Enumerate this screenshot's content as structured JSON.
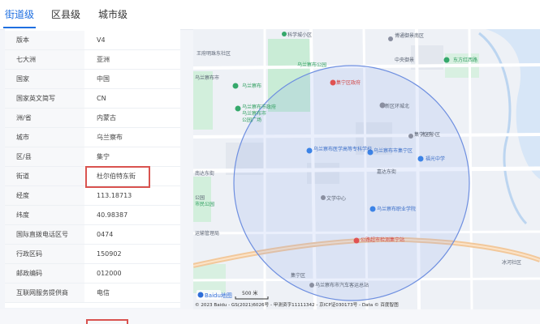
{
  "tabs": [
    "街道级",
    "区县级",
    "城市级"
  ],
  "info_rows": [
    {
      "key": "版本",
      "value": "V4"
    },
    {
      "key": "七大洲",
      "value": "亚洲"
    },
    {
      "key": "国家",
      "value": "中国"
    },
    {
      "key": "国家英文简写",
      "value": "CN"
    },
    {
      "key": "洲/省",
      "value": "内蒙古"
    },
    {
      "key": "城市",
      "value": "乌兰察布"
    },
    {
      "key": "区/县",
      "value": "集宁"
    },
    {
      "key": "街道",
      "value": "杜尔伯特东街"
    },
    {
      "key": "经度",
      "value": "113.18713"
    },
    {
      "key": "纬度",
      "value": "40.98387"
    },
    {
      "key": "国际直拨电话区号",
      "value": "0474"
    },
    {
      "key": "行政区码",
      "value": "150902"
    },
    {
      "key": "邮政编码",
      "value": "012000"
    },
    {
      "key": "互联网服务提供商",
      "value": "电信"
    }
  ],
  "highlight_color": "#d9534f",
  "accent_color": "#1f6fe0",
  "map": {
    "labels": [
      "博通御景南区",
      "科学城小区",
      "中央御景",
      "东方红西路",
      "王府明珠东社区",
      "乌兰察布公园",
      "集宁区政府",
      "新区环城北",
      "乌兰察布",
      "乌兰察布市政府",
      "乌兰察布市",
      "乌兰察布市",
      "公园广场",
      "集宁区东",
      "乌兰察布医学高等专科学校",
      "乌兰察布市集宁区",
      "乌兰察布职业学院",
      "嘉达东街",
      "文学中心",
      "南达东街",
      "福光中学",
      "冰河小区",
      "公路超市检测集宁站",
      "市民公园",
      "乌兰察布市汽车客运总站",
      "集宁区",
      "运输管理局",
      "冰河社区",
      "公园"
    ],
    "scale_label": "500 米",
    "logo_label": "Baidu地图",
    "copyright": "© 2023 Baidu - GS(2021)6026号 - 甲测资字11111342 - 京ICP证030173号 - Data © 百度智图"
  }
}
